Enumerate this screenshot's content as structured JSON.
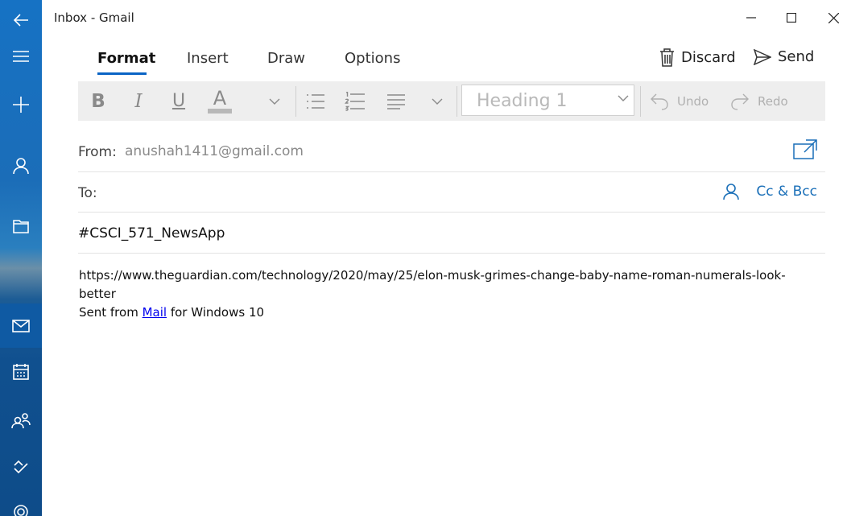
{
  "window": {
    "title": "Inbox - Gmail"
  },
  "rail": {
    "items": [
      {
        "name": "back-arrow-icon"
      },
      {
        "name": "hamburger-menu-icon"
      },
      {
        "name": "new-mail-icon"
      },
      {
        "name": "account-icon"
      },
      {
        "name": "folders-icon"
      },
      {
        "name": "mail-icon"
      },
      {
        "name": "calendar-icon"
      },
      {
        "name": "people-icon"
      },
      {
        "name": "todo-icon"
      },
      {
        "name": "settings-icon"
      }
    ]
  },
  "tabs": [
    {
      "label": "Format",
      "active": true
    },
    {
      "label": "Insert"
    },
    {
      "label": "Draw"
    },
    {
      "label": "Options"
    }
  ],
  "actions": {
    "discard": "Discard",
    "send": "Send"
  },
  "toolbar": {
    "bold": "B",
    "italic": "I",
    "underline": "U",
    "font_color": "A",
    "style_value": "Heading 1",
    "undo": "Undo",
    "redo": "Redo",
    "accent_color": "#0a64c5"
  },
  "compose": {
    "from_label": "From:",
    "from_value": "anushah1411@gmail.com",
    "to_label": "To:",
    "cc_bcc": "Cc & Bcc",
    "subject": "#CSCI_571_NewsApp",
    "body_line1": "https://www.theguardian.com/technology/2020/may/25/elon-musk-grimes-change-baby-name-roman-numerals-look-better",
    "signature_prefix": "Sent from ",
    "signature_link": "Mail",
    "signature_suffix": " for Windows 10"
  }
}
